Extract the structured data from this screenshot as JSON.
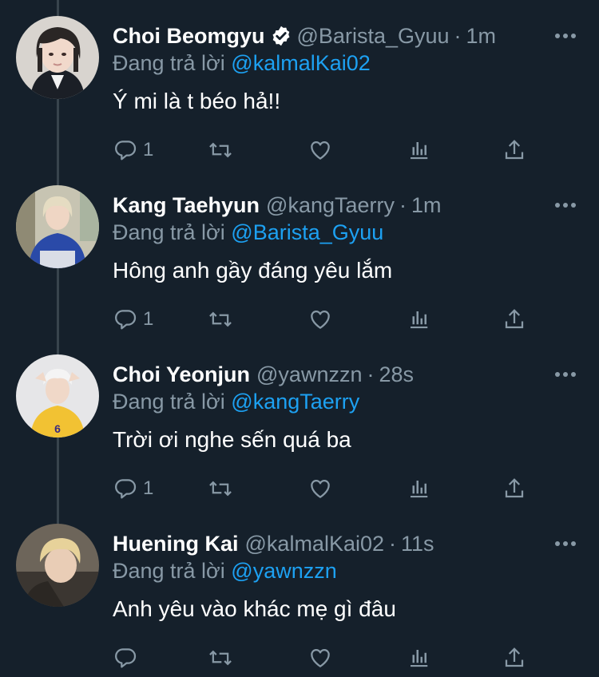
{
  "colors": {
    "background": "#15202b",
    "text": "#ffffff",
    "secondary": "#8899a6",
    "mention": "#1da1f2",
    "thread_line": "#38444d"
  },
  "labels": {
    "replying_to": "Đang trả lời",
    "separator": "·"
  },
  "tweets": [
    {
      "name": "Choi Beomgyu",
      "verified": true,
      "handle": "@Barista_Gyuu",
      "time": "1m",
      "reply_to": "@kalmalKai02",
      "text": "Ý mi là t béo hả!!",
      "reply_count": "1",
      "avatar": "avatar-beomgyu"
    },
    {
      "name": "Kang Taehyun",
      "verified": false,
      "handle": "@kangTaerry",
      "time": "1m",
      "reply_to": "@Barista_Gyuu",
      "text": "Hông anh gầy đáng yêu lắm",
      "reply_count": "1",
      "avatar": "avatar-taehyun"
    },
    {
      "name": "Choi Yeonjun",
      "verified": false,
      "handle": "@yawnzzn",
      "time": "28s",
      "reply_to": "@kangTaerry",
      "text": "Trời ơi nghe sến quá ba",
      "reply_count": "1",
      "avatar": "avatar-yeonjun"
    },
    {
      "name": "Huening Kai",
      "verified": false,
      "handle": "@kalmalKai02",
      "time": "11s",
      "reply_to": "@yawnzzn",
      "text": "Anh yêu vào khác mẹ gì đâu",
      "reply_count": "",
      "avatar": "avatar-kai"
    }
  ]
}
